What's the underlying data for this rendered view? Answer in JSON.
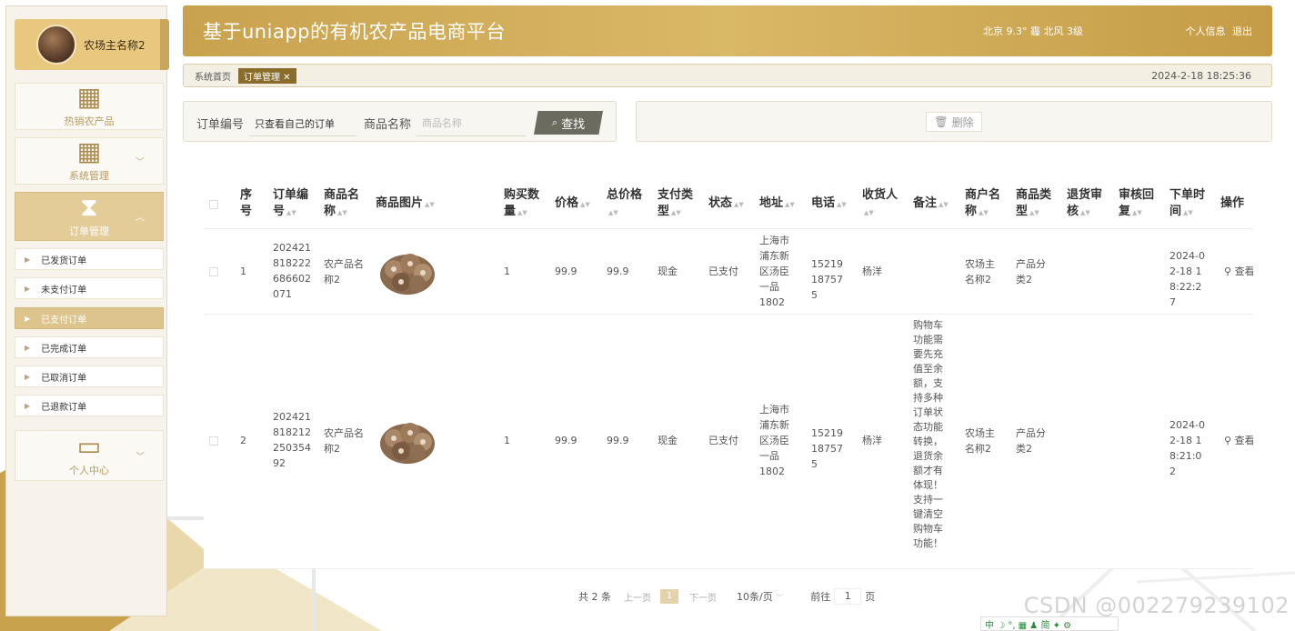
{
  "app": {
    "title": "基于uniapp的有机农产品电商平台"
  },
  "header": {
    "weather": "北京  9.3°  霾  北风  3级",
    "profile": "个人信息",
    "logout": "退出"
  },
  "user": {
    "name": "农场主名称2"
  },
  "sidebar": {
    "menus": [
      {
        "label": "热销农产品",
        "icon": "grid-icon"
      },
      {
        "label": "系统管理",
        "icon": "grid-icon"
      },
      {
        "label": "订单管理",
        "icon": "ticket-icon"
      },
      {
        "label": "个人中心",
        "icon": "card-icon"
      }
    ],
    "sub_items": [
      "已发货订单",
      "未支付订单",
      "已支付订单",
      "已完成订单",
      "已取消订单",
      "已退款订单"
    ]
  },
  "breadcrumb": {
    "home": "系统首页",
    "current": "订单管理 ✕",
    "time": "2024-2-18 18:25:36"
  },
  "search": {
    "order_label": "订单编号",
    "order_value": "只查看自己的订单",
    "product_label": "商品名称",
    "product_placeholder": "商品名称",
    "find_label": "查找"
  },
  "actions": {
    "delete_label": "删除"
  },
  "table": {
    "columns": [
      "序号",
      "订单编号",
      "商品名称",
      "商品图片",
      "购买数量",
      "价格",
      "总价格",
      "支付类型",
      "状态",
      "地址",
      "电话",
      "收货人",
      "备注",
      "商户名称",
      "商品类型",
      "退货审核",
      "审核回复",
      "下单时间",
      "操作"
    ],
    "rows": [
      {
        "index": "1",
        "order_no": "202421818222686602071",
        "product": "农产品名称2",
        "qty": "1",
        "price": "99.9",
        "total": "99.9",
        "pay_type": "现金",
        "status": "已支付",
        "address": "上海市浦东新区汤臣一品1802",
        "phone": "15219187575",
        "receiver": "杨洋",
        "remark": "",
        "merchant": "农场主名称2",
        "category": "产品分类2",
        "return_review": "",
        "review_reply": "",
        "order_time": "2024-02-18 18:22:27",
        "op": "查看"
      },
      {
        "index": "2",
        "order_no": "20242181821225035492",
        "product": "农产品名称2",
        "qty": "1",
        "price": "99.9",
        "total": "99.9",
        "pay_type": "现金",
        "status": "已支付",
        "address": "上海市浦东新区汤臣一品1802",
        "phone": "15219187575",
        "receiver": "杨洋",
        "remark": "购物车功能需要先充值至余额，支持多种订单状态功能转换，退货余额才有体现！支持一键清空购物车功能！",
        "merchant": "农场主名称2",
        "category": "产品分类2",
        "return_review": "",
        "review_reply": "",
        "order_time": "2024-02-18 18:21:02",
        "op": "查看"
      }
    ]
  },
  "pager": {
    "total": "共 2 条",
    "prev": "上一页",
    "current": "1",
    "next": "下一页",
    "size": "10条/页",
    "goto": "前往",
    "goto_value": "1",
    "page_unit": "页"
  },
  "watermark": "CSDN @00227923910​2",
  "tray": "中 ☽ °, ▦ ♟ 简 ✦ ⚙"
}
